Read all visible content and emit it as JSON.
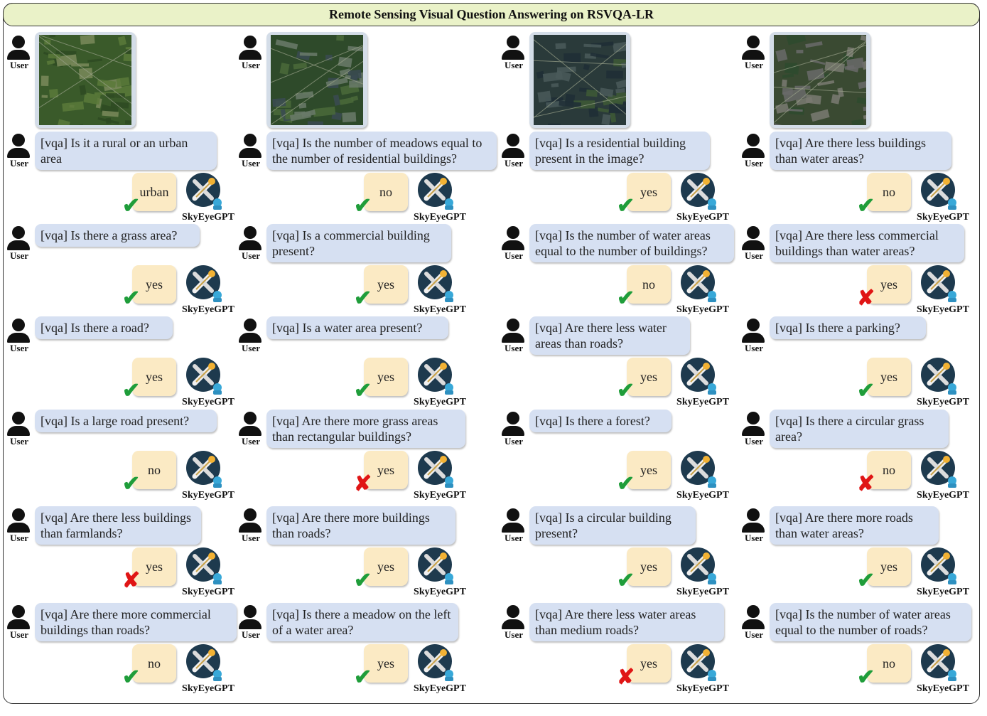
{
  "title": "Remote Sensing Visual Question Answering on RSVQA-LR",
  "user_label": "User",
  "bot_label": "SkyEyeGPT",
  "columns": [
    {
      "image": "satellite-farmland-image",
      "qa": [
        {
          "q": "[vqa] Is it a rural or an urban area",
          "a": "urban",
          "correct": true
        },
        {
          "q": "[vqa] Is there a grass area?",
          "a": "yes",
          "correct": true
        },
        {
          "q": "[vqa] Is there a road?",
          "a": "yes",
          "correct": true
        },
        {
          "q": "[vqa] Is a large road present?",
          "a": "no",
          "correct": true
        },
        {
          "q": "[vqa] Are there less buildings than farmlands?",
          "a": "yes",
          "correct": false
        },
        {
          "q": "[vqa] Are there more commercial buildings than roads?",
          "a": "no",
          "correct": true
        }
      ]
    },
    {
      "image": "satellite-river-town-image",
      "qa": [
        {
          "q": "[vqa] Is the number of meadows equal to the number of residential buildings?",
          "a": "no",
          "correct": true
        },
        {
          "q": "[vqa] Is a commercial building present?",
          "a": "yes",
          "correct": true
        },
        {
          "q": "[vqa] Is a water area present?",
          "a": "yes",
          "correct": true
        },
        {
          "q": "[vqa] Are there more grass areas than rectangular buildings?",
          "a": "yes",
          "correct": false
        },
        {
          "q": "[vqa] Are there more buildings than roads?",
          "a": "yes",
          "correct": true
        },
        {
          "q": "[vqa] Is there a meadow on the left of a water area?",
          "a": "yes",
          "correct": true
        }
      ]
    },
    {
      "image": "satellite-lake-image",
      "qa": [
        {
          "q": "[vqa] Is a residential building present in the image?",
          "a": "yes",
          "correct": true
        },
        {
          "q": "[vqa] Is the number of water areas equal to the number of buildings?",
          "a": "no",
          "correct": true
        },
        {
          "q": "[vqa] Are there less water areas than roads?",
          "a": "yes",
          "correct": true
        },
        {
          "q": "[vqa] Is there a forest?",
          "a": "yes",
          "correct": true
        },
        {
          "q": "[vqa] Is a circular building present?",
          "a": "yes",
          "correct": true
        },
        {
          "q": "[vqa] Are there less water areas than medium roads?",
          "a": "yes",
          "correct": false
        }
      ]
    },
    {
      "image": "satellite-suburb-image",
      "qa": [
        {
          "q": "[vqa] Are there less buildings than water areas?",
          "a": "no",
          "correct": true
        },
        {
          "q": "[vqa] Are there less commercial buildings than water areas?",
          "a": "yes",
          "correct": false
        },
        {
          "q": "[vqa] Is there a parking?",
          "a": "yes",
          "correct": true
        },
        {
          "q": "[vqa] Is there a circular grass area?",
          "a": "no",
          "correct": false
        },
        {
          "q": "[vqa] Are there more roads than water areas?",
          "a": "yes",
          "correct": true
        },
        {
          "q": "[vqa] Is the number of water areas equal to the number of roads?",
          "a": "no",
          "correct": true
        }
      ]
    }
  ]
}
